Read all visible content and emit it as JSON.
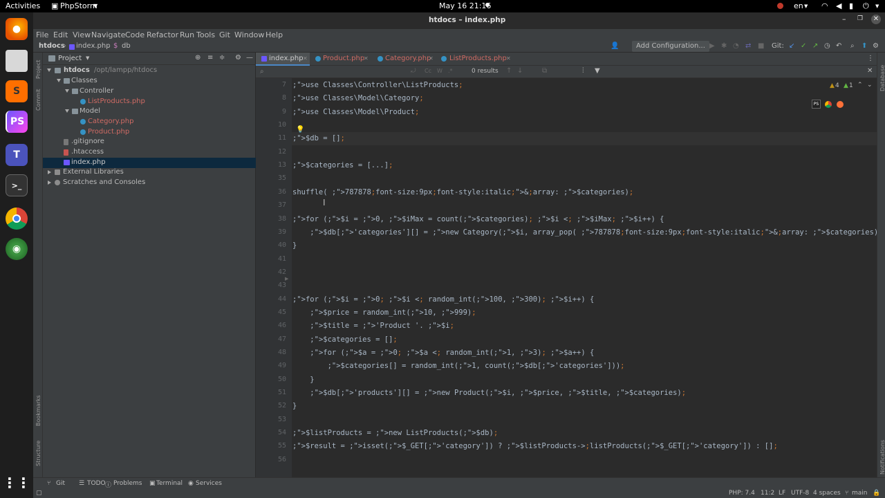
{
  "topbar": {
    "activities": "Activities",
    "app_name": "PhpStorm",
    "datetime": "May 16  21:16",
    "lang": "en"
  },
  "window": {
    "title": "htdocs – index.php"
  },
  "menu": [
    "File",
    "Edit",
    "View",
    "Navigate",
    "Code",
    "Refactor",
    "Run",
    "Tools",
    "Git",
    "Window",
    "Help"
  ],
  "breadcrumb": {
    "root": "htdocs",
    "file": "index.php",
    "symbol": "db"
  },
  "toolbar": {
    "add_config": "Add Configuration...",
    "git_label": "Git:"
  },
  "project": {
    "header": "Project",
    "root_name": "htdocs",
    "root_path": "/opt/lampp/htdocs",
    "items": [
      {
        "label": "Classes",
        "kind": "folder"
      },
      {
        "label": "Controller",
        "kind": "folder"
      },
      {
        "label": "ListProducts.php",
        "kind": "class"
      },
      {
        "label": "Model",
        "kind": "folder"
      },
      {
        "label": "Category.php",
        "kind": "class"
      },
      {
        "label": "Product.php",
        "kind": "class"
      },
      {
        "label": ".gitignore",
        "kind": "file"
      },
      {
        "label": ".htaccess",
        "kind": "file"
      },
      {
        "label": "index.php",
        "kind": "php"
      },
      {
        "label": "External Libraries",
        "kind": "lib"
      },
      {
        "label": "Scratches and Consoles",
        "kind": "scratch"
      }
    ]
  },
  "tabs": [
    "index.php",
    "Product.php",
    "Category.php",
    "ListProducts.php"
  ],
  "find": {
    "results": "0 results"
  },
  "inspections": {
    "warnings": "4",
    "weak": "1"
  },
  "gutter_lines": [
    "7",
    "8",
    "9",
    "10",
    "11",
    "12",
    "13",
    "35",
    "36",
    "37",
    "38",
    "39",
    "40",
    "41",
    "42",
    "43",
    "44",
    "45",
    "46",
    "47",
    "48",
    "49",
    "50",
    "51",
    "52",
    "53",
    "54",
    "55",
    "56"
  ],
  "code_lines": [
    "use Classes\\Controller\\ListProducts;",
    "use Classes\\Model\\Category;",
    "use Classes\\Model\\Product;",
    "",
    "$db = [];",
    "",
    "$categories = [...];",
    "",
    "shuffle( &array: $categories);",
    "",
    "for ($i = 0, $iMax = count($categories); $i < $iMax; $i++) {",
    "    $db['categories'][] = new Category($i, array_pop( &array: $categories));",
    "}",
    "",
    "",
    "",
    "for ($i = 0; $i < random_int(100, 300); $i++) {",
    "    $price = random_int(10, 999);",
    "    $title = 'Product '. $i;",
    "    $categories = [];",
    "    for ($a = 0; $a < random_int(1, 3); $a++) {",
    "        $categories[] = random_int(1, count($db['categories']));",
    "    }",
    "    $db['products'][] = new Product($i, $price, $title, $categories);",
    "}",
    "",
    "$listProducts = new ListProducts($db);",
    "$result = isset($_GET['category']) ? $listProducts->listProducts($_GET['category']) : [];",
    ""
  ],
  "left_tools": [
    "Project",
    "Commit"
  ],
  "left_tools_bottom": [
    "Bookmarks",
    "Structure"
  ],
  "right_tools": [
    "Database",
    "Notifications"
  ],
  "bottom_tools": [
    "Git",
    "TODO",
    "Problems",
    "Terminal",
    "Services"
  ],
  "status": {
    "php": "PHP: 7.4",
    "pos": "11:2",
    "eol": "LF",
    "enc": "UTF-8",
    "indent": "4 spaces",
    "branch": "main"
  }
}
